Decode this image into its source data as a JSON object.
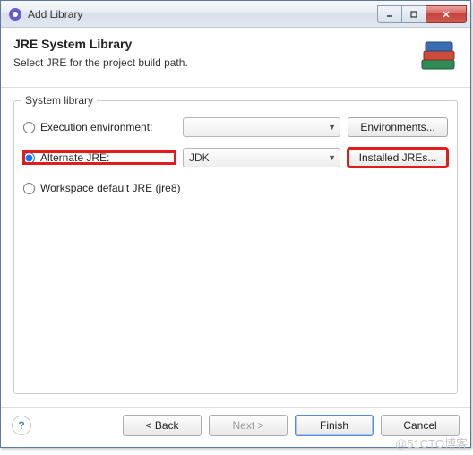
{
  "title": "Add Library",
  "header": {
    "title": "JRE System Library",
    "subtitle": "Select JRE for the project build path."
  },
  "group": {
    "title": "System library",
    "exec_env": {
      "label": "Execution environment:",
      "value": "",
      "button": "Environments..."
    },
    "alt_jre": {
      "label": "Alternate JRE:",
      "value": "JDK",
      "button": "Installed JREs..."
    },
    "workspace": {
      "label": "Workspace default JRE (jre8)"
    },
    "selected": "alt_jre"
  },
  "buttons": {
    "back": "< Back",
    "next": "Next >",
    "finish": "Finish",
    "cancel": "Cancel"
  },
  "watermark": "@51CTO博客"
}
